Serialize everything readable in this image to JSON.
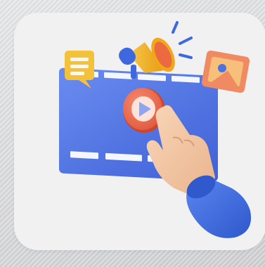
{
  "scene": {
    "background_color": "#d9dadc",
    "card_color": "#f1f1f2",
    "accent_colors": {
      "player_blue": "#5577e6",
      "play_button_red": "#ef6a4f",
      "megaphone_yellow": "#f2b522",
      "chat_yellow": "#f3c13a",
      "image_card_orange": "#ef8a63",
      "sleeve_blue": "#3f6fe0",
      "skin": "#f4c9a4"
    },
    "icons": [
      "video-player-icon",
      "play-button-icon",
      "megaphone-icon",
      "chat-bubble-icon",
      "image-card-icon",
      "pointing-hand-icon"
    ]
  }
}
